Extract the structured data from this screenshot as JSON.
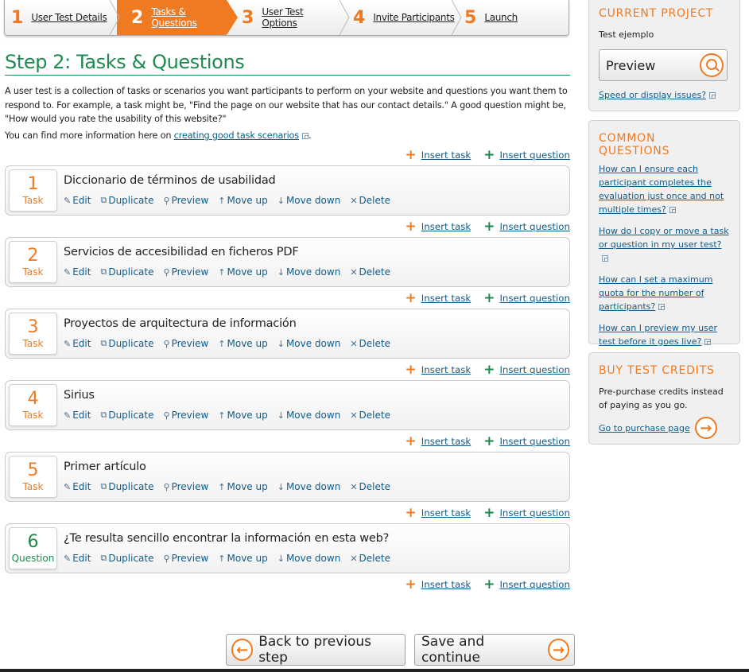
{
  "wizard": {
    "steps": [
      {
        "num": "1",
        "label": "User Test Details"
      },
      {
        "num": "2",
        "label": "Tasks & Questions"
      },
      {
        "num": "3",
        "label": "User Test Options"
      },
      {
        "num": "4",
        "label": "Invite Participants"
      },
      {
        "num": "5",
        "label": "Launch"
      }
    ]
  },
  "page": {
    "title": "Step 2: Tasks & Questions",
    "intro": "A user test is a collection of tasks or scenarios you want participants to perform on your website and questions you want them to respond to. For example, a task might be, \"Find the page on our website that has our contact details.\" A good question might be, \"How would you rate the usability of this website?\"",
    "more_prefix": "You can find more information here on ",
    "more_link": "creating good task scenarios",
    "more_suffix": "."
  },
  "insert": {
    "task": "Insert task",
    "question": "Insert question"
  },
  "actions": {
    "edit": "Edit",
    "duplicate": "Duplicate",
    "preview": "Preview",
    "move_up": "Move up",
    "move_down": "Move down",
    "delete": "Delete"
  },
  "items": [
    {
      "num": "1",
      "type": "Task",
      "title": "Diccionario de términos de usabilidad"
    },
    {
      "num": "2",
      "type": "Task",
      "title": "Servicios de accesibilidad en ficheros PDF"
    },
    {
      "num": "3",
      "type": "Task",
      "title": "Proyectos de arquitectura de información"
    },
    {
      "num": "4",
      "type": "Task",
      "title": "Sirius"
    },
    {
      "num": "5",
      "type": "Task",
      "title": "Primer artículo"
    },
    {
      "num": "6",
      "type": "Question",
      "title": "¿Te resulta sencillo encontrar la información en esta web?"
    }
  ],
  "buttons": {
    "back": "Back to previous step",
    "save": "Save and continue"
  },
  "sidebar": {
    "current_project": {
      "heading": "CURRENT PROJECT",
      "name": "Test ejemplo",
      "preview": "Preview",
      "issues_link": "Speed or display issues?"
    },
    "common_questions": {
      "heading": "COMMON QUESTIONS",
      "links": [
        "How can I ensure each participant completes the evaluation just once and not multiple times?",
        "How do I copy or move a task or question in my user test?",
        "How can I set a maximum quota for the number of participants?",
        "How can I preview my user test before it goes live?"
      ]
    },
    "buy_credits": {
      "heading": "BUY TEST CREDITS",
      "text": "Pre-purchase credits instead of paying as you go.",
      "link": "Go to purchase page"
    }
  },
  "colors": {
    "accent": "#f07a21",
    "green": "#1f8a4f",
    "link": "#0f5c8c"
  }
}
